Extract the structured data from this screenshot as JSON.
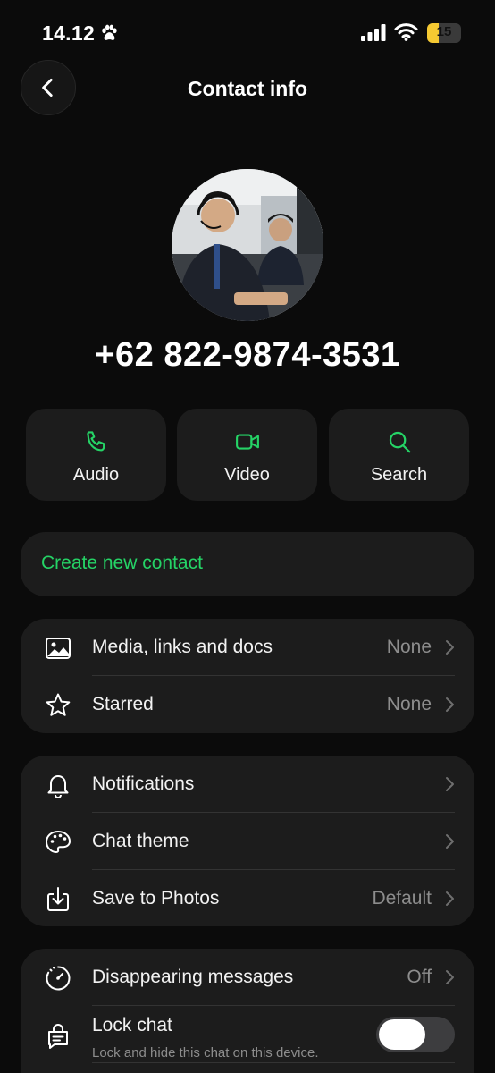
{
  "status_bar": {
    "time": "14.12",
    "battery": "15",
    "battery_level": 0.15
  },
  "header": {
    "title": "Contact info",
    "back_icon": "chevron-left-icon"
  },
  "contact": {
    "phone": "+62 822-9874-3531"
  },
  "actions": [
    {
      "label": "Audio",
      "icon": "phone-icon"
    },
    {
      "label": "Video",
      "icon": "video-icon"
    },
    {
      "label": "Search",
      "icon": "search-icon"
    }
  ],
  "create_contact": {
    "label": "Create new contact"
  },
  "group1": [
    {
      "label": "Media, links and docs",
      "value": "None",
      "icon": "image-icon"
    },
    {
      "label": "Starred",
      "value": "None",
      "icon": "star-icon"
    }
  ],
  "group2": [
    {
      "label": "Notifications",
      "value": "",
      "icon": "bell-icon"
    },
    {
      "label": "Chat theme",
      "value": "",
      "icon": "palette-icon"
    },
    {
      "label": "Save to Photos",
      "value": "Default",
      "icon": "download-icon"
    }
  ],
  "group3": {
    "disappearing": {
      "label": "Disappearing messages",
      "value": "Off",
      "icon": "timer-icon"
    },
    "lock": {
      "label": "Lock chat",
      "sublabel": "Lock and hide this chat on this device.",
      "icon": "lock-chat-icon",
      "enabled": false
    }
  },
  "colors": {
    "accent": "#25d366",
    "background": "#0b0b0b",
    "card": "#1c1c1c",
    "secondary_text": "#8d8d8d"
  }
}
